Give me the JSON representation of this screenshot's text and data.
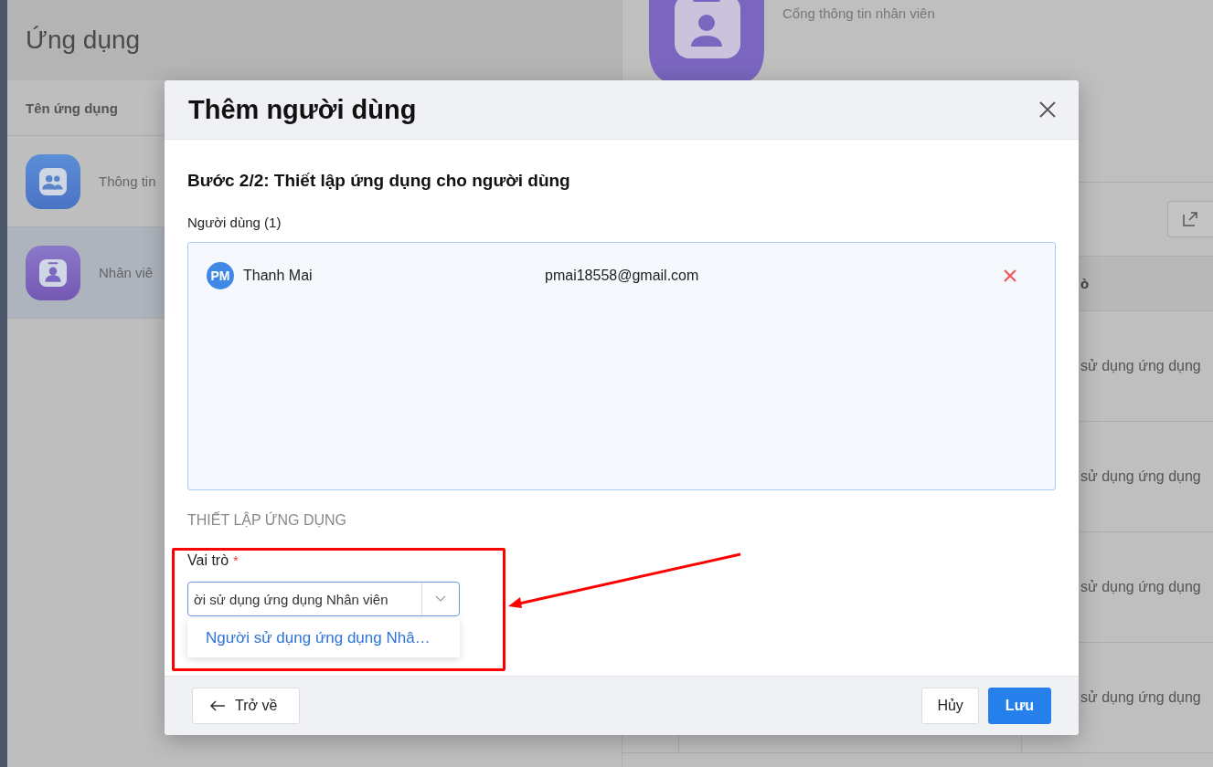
{
  "apps_panel": {
    "title": "Ứng dụng",
    "column_header": "Tên ứng dụng",
    "rows": [
      {
        "name": "Thông tin",
        "kind": "people",
        "selected": false
      },
      {
        "name": "Nhân viê",
        "kind": "badge",
        "selected": true
      }
    ]
  },
  "detail_panel": {
    "description": "Cổng thông tin nhân viên",
    "column_header": "ò",
    "rows": [
      "sử dụng ứng dụng",
      "sử dụng ứng dụng",
      "sử dụng ứng dụng",
      "sử dụng ứng dụng"
    ]
  },
  "dialog": {
    "title": "Thêm người dùng",
    "step": "Bước 2/2: Thiết lập ứng dụng cho người dùng",
    "users_label": "Người dùng (1)",
    "users": [
      {
        "initials": "PM",
        "name": "Thanh Mai",
        "email": "pmai18558@gmail.com"
      }
    ],
    "section": "THIẾT LẬP ỨNG DỤNG",
    "role_field": {
      "label": "Vai trò",
      "required_mark": "*",
      "value": "ời sử dụng ứng dụng Nhân viên",
      "options": [
        {
          "label": "Người sử dụng ứng dụng Nhâ…",
          "selected": true
        }
      ]
    },
    "buttons": {
      "back": "Trở về",
      "cancel": "Hủy",
      "save": "Lưu"
    }
  }
}
